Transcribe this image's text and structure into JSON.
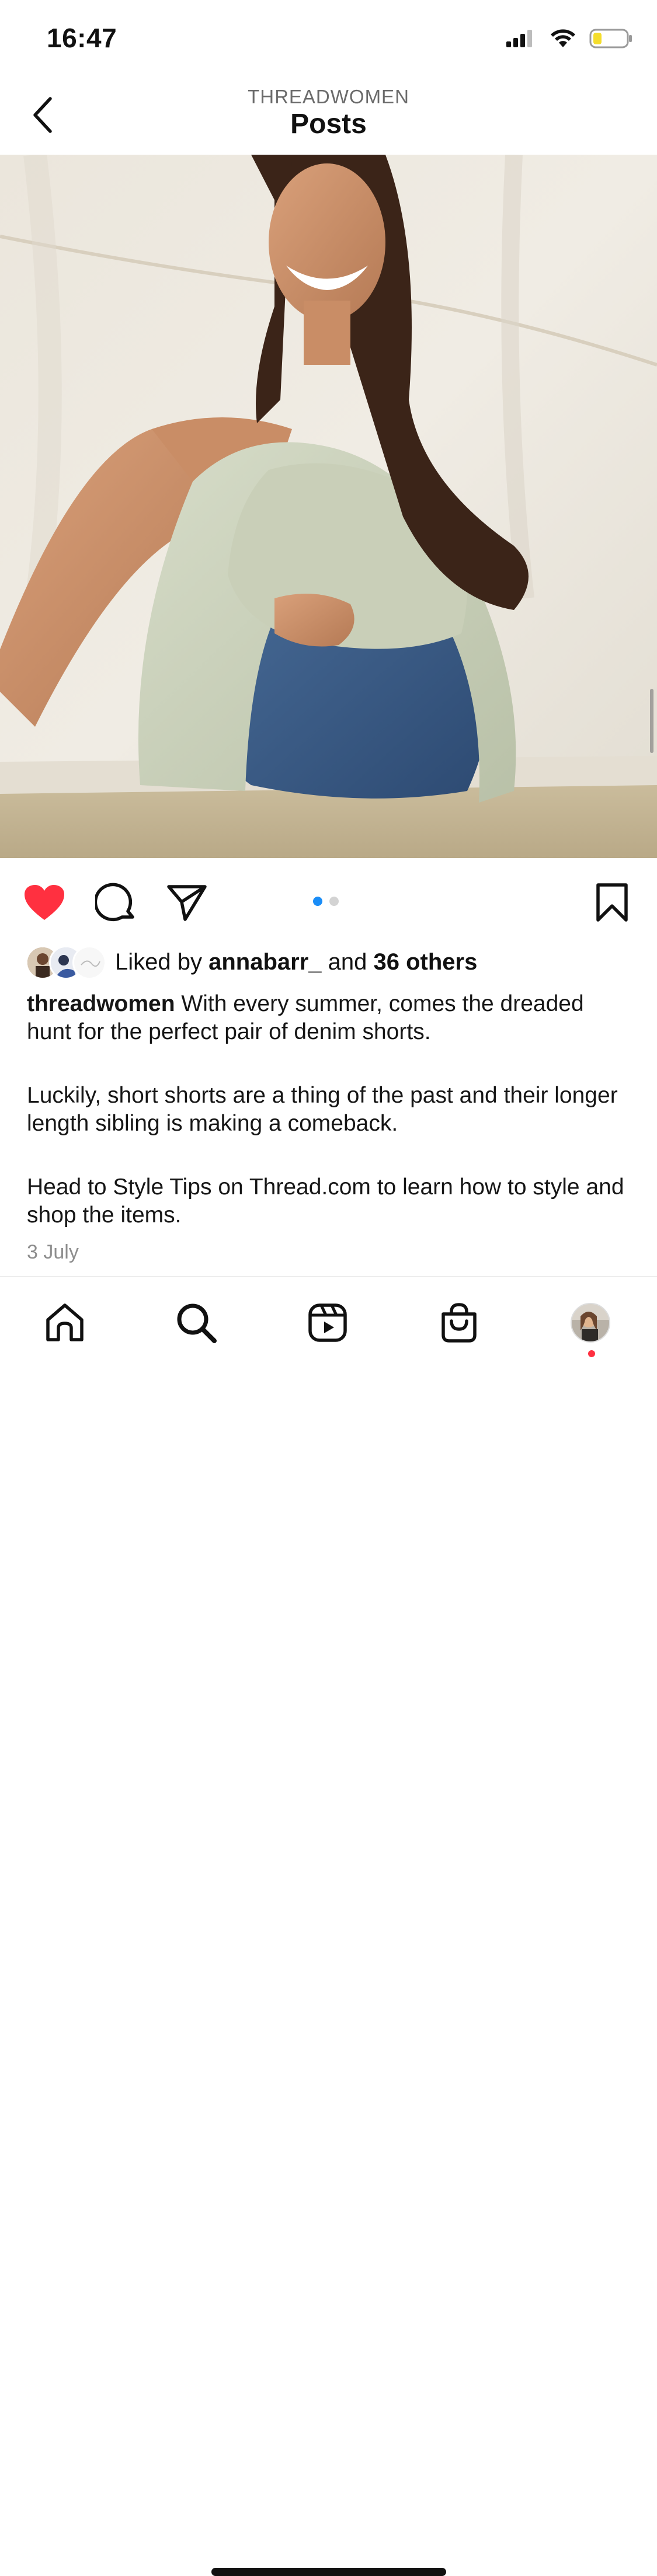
{
  "status_bar": {
    "time": "16:47",
    "battery_color": "#f4dd2c"
  },
  "header": {
    "subtitle": "THREADWOMEN",
    "title": "Posts"
  },
  "post": {
    "liked": true,
    "carousel": {
      "total": 2,
      "current": 1
    },
    "likes": {
      "prefix": "Liked by ",
      "user": "annabarr_",
      "middle": " and ",
      "others": "36 others"
    },
    "caption": {
      "username": "threadwomen",
      "paragraph1": " With every summer, comes the dreaded hunt for the perfect pair of denim shorts.",
      "paragraph2": "Luckily, short shorts are a thing of the past and their longer length sibling is making a comeback.",
      "paragraph3": "Head to Style Tips on Thread.com to learn how to style and shop the items."
    },
    "date": "3 July"
  },
  "tab_bar": {
    "tabs": [
      "home-icon",
      "search-icon",
      "reels-icon",
      "shop-icon",
      "profile-avatar"
    ],
    "notification_dot": true
  },
  "colors": {
    "like": "#ff3040",
    "accent": "#1a8df7",
    "muted": "#8e8e8e"
  }
}
